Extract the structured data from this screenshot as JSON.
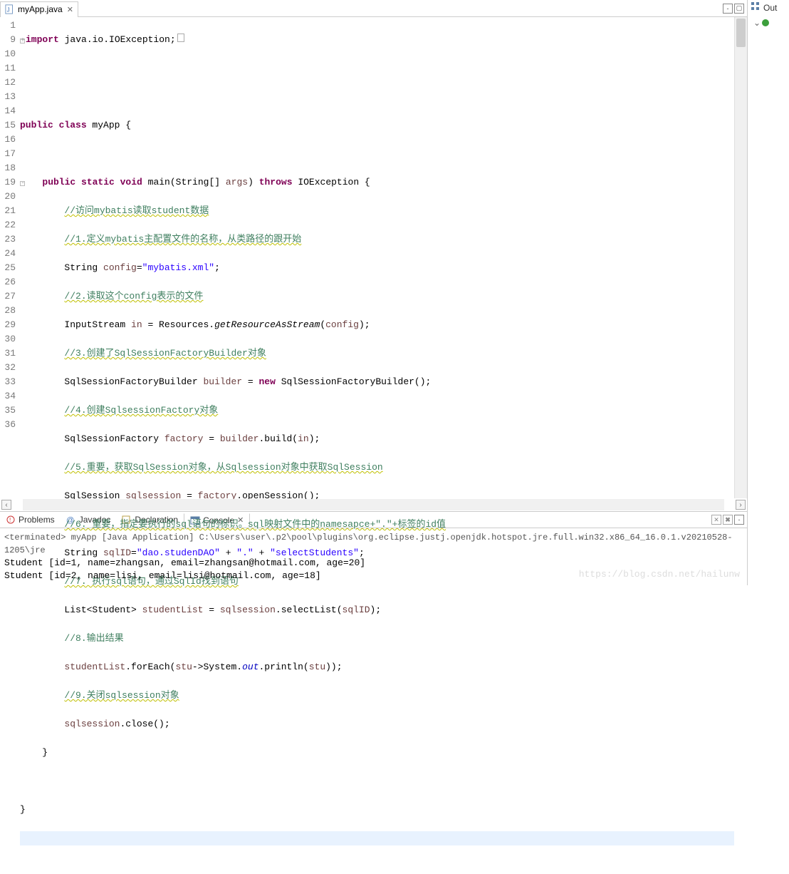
{
  "tabs": {
    "editor_title": "myApp.java"
  },
  "outline": {
    "header": "Out"
  },
  "gutter": [
    "1",
    "9",
    "10",
    "11",
    "12",
    "13",
    "14",
    "15",
    "16",
    "17",
    "18",
    "19",
    "20",
    "21",
    "22",
    "23",
    "24",
    "25",
    "26",
    "27",
    "28",
    "29",
    "30",
    "31",
    "32",
    "33",
    "34",
    "35",
    "36"
  ],
  "code": {
    "l1_import": "import",
    "l1_rest": " java.io.IOException;",
    "l11_a": "public class",
    "l11_b": " myApp {",
    "l13_a": "public static void",
    "l13_b": " main(String[] ",
    "l13_c": "args",
    "l13_d": ") ",
    "l13_e": "throws",
    "l13_f": " IOException {",
    "c14": "//访问mybatis读取student数据",
    "c15": "//1.定义mybatis主配置文件的名称，从类路径的跟开始",
    "l16_a": "String ",
    "l16_b": "config",
    "l16_c": "=",
    "l16_d": "\"mybatis.xml\"",
    "l16_e": ";",
    "c17": "//2.读取这个config表示的文件",
    "l18_a": "InputStream ",
    "l18_b": "in",
    "l18_c": " = Resources.",
    "l18_d": "getResourceAsStream",
    "l18_e": "(",
    "l18_f": "config",
    "l18_g": ");",
    "c19": "//3.创建了SqlSessionFactoryBuilder对象",
    "l20_a": "SqlSessionFactoryBuilder ",
    "l20_b": "builder",
    "l20_c": " = ",
    "l20_d": "new",
    "l20_e": " SqlSessionFactoryBuilder();",
    "c21": "//4.创建SqlsessionFactory对象",
    "l22_a": "SqlSessionFactory ",
    "l22_b": "factory",
    "l22_c": " = ",
    "l22_d": "builder",
    "l22_e": ".build(",
    "l22_f": "in",
    "l22_g": ");",
    "c23": "//5.重要，获取SqlSession对象，从Sqlsession对象中获取SqlSession",
    "l24_a": "SqlSession ",
    "l24_b": "sqlsession",
    "l24_c": " = ",
    "l24_d": "factory",
    "l24_e": ".openSession();",
    "c25": "//6. 重要，指定要执行的sql语句的标识。sql映射文件中的namesapce+\".\"+标签的id值",
    "l26_a": "String ",
    "l26_b": "sqlID",
    "l26_c": "=",
    "l26_d": "\"dao.studenDAO\"",
    "l26_e": " + ",
    "l26_f": "\".\"",
    "l26_g": " + ",
    "l26_h": "\"selectStudents\"",
    "l26_i": ";",
    "c27": "//7. 执行sql语句，通过SqlId找到语句",
    "l28_a": "List<Student> ",
    "l28_b": "studentList",
    "l28_c": " = ",
    "l28_d": "sqlsession",
    "l28_e": ".selectList(",
    "l28_f": "sqlID",
    "l28_g": ");",
    "c29": "//8.输出结果",
    "l30_a": "studentList",
    "l30_b": ".forEach(",
    "l30_c": "stu",
    "l30_d": "->System.",
    "l30_e": "out",
    "l30_f": ".println(",
    "l30_g": "stu",
    "l30_h": "));",
    "c31": "//9.关闭sqlsession对象",
    "l32_a": "sqlsession",
    "l32_b": ".close();",
    "l33": "}",
    "l35": "}"
  },
  "bottom": {
    "problems": "Problems",
    "javadoc": "Javadoc",
    "declaration": "Declaration",
    "console": "Console"
  },
  "console": {
    "status": "<terminated> myApp [Java Application] C:\\Users\\user\\.p2\\pool\\plugins\\org.eclipse.justj.openjdk.hotspot.jre.full.win32.x86_64_16.0.1.v20210528-1205\\jre",
    "out1": "Student [id=1, name=zhangsan, email=zhangsan@hotmail.com, age=20]",
    "out2": "Student [id=2, name=lisi, email=lisi@hotmail.com, age=18]"
  },
  "watermark": "https://blog.csdn.net/hailunw"
}
